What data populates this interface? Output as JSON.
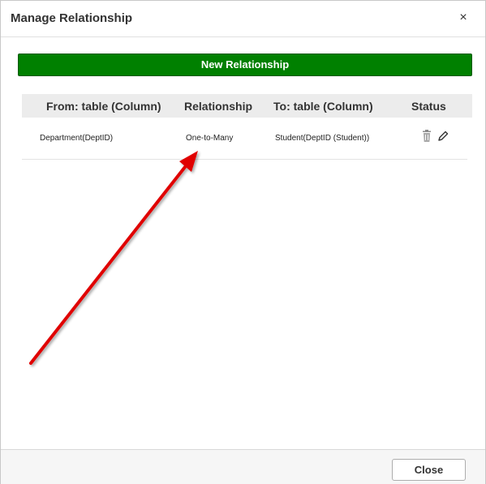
{
  "dialog": {
    "title": "Manage Relationship",
    "close_icon": "close-icon",
    "close_glyph": "×"
  },
  "toolbar": {
    "new_relationship_label": "New Relationship",
    "accent_color": "#008000"
  },
  "table": {
    "columns": [
      "From: table (Column)",
      "Relationship",
      "To: table (Column)",
      "Status"
    ],
    "rows": [
      {
        "from": "Department(DeptID)",
        "relationship": "One-to-Many",
        "to": "Student(DeptID (Student))",
        "status_icons": [
          "trash-icon",
          "pencil-edit-icon"
        ]
      }
    ]
  },
  "footer": {
    "close_label": "Close"
  },
  "annotation": {
    "type": "arrow",
    "color": "#e00000",
    "icon": "red-arrow-annotation"
  }
}
